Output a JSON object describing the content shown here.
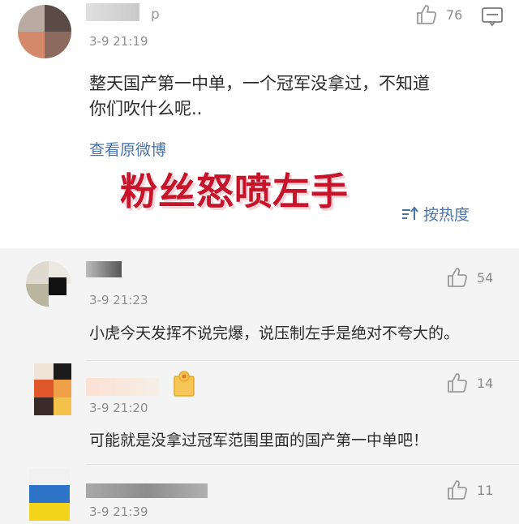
{
  "comments": [
    {
      "username_suffix": "p",
      "time": "3-9 21:19",
      "likes": "76",
      "content_line1": "整天国产第一中单，一个冠军没拿过，不知道",
      "content_line2": "你们吹什么呢.."
    },
    {
      "time": "3-9 21:23",
      "likes": "54",
      "content": "小虎今天发挥不说完爆，说压制左手是绝对不夸大的。"
    },
    {
      "time": "3-9 21:20",
      "likes": "14",
      "content": "可能就是没拿过冠军范围里面的国产第一中单吧！"
    },
    {
      "time": "3-9 21:39",
      "likes": "11"
    }
  ],
  "view_original_label": "查看原微博",
  "overlay_caption": "粉丝怒喷左手",
  "sort_label": "按热度",
  "icons": {
    "like": "thumbs-up-icon",
    "comment": "comment-icon",
    "sort": "sort-icon",
    "badge": "vip-badge-icon"
  },
  "colors": {
    "link": "#4a74a6",
    "caption": "#c8142a"
  }
}
